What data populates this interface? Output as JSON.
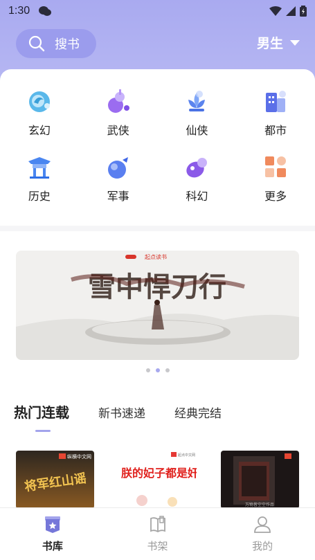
{
  "status_bar": {
    "time": "1:30"
  },
  "header": {
    "search_label": "搜书",
    "gender_label": "男生"
  },
  "categories": [
    {
      "label": "玄幻",
      "icon": "xuanhuan-icon"
    },
    {
      "label": "武侠",
      "icon": "wuxia-icon"
    },
    {
      "label": "仙侠",
      "icon": "xianxia-icon"
    },
    {
      "label": "都市",
      "icon": "dushi-icon"
    },
    {
      "label": "历史",
      "icon": "lishi-icon"
    },
    {
      "label": "军事",
      "icon": "junshi-icon"
    },
    {
      "label": "科幻",
      "icon": "kehuan-icon"
    },
    {
      "label": "更多",
      "icon": "more-icon"
    }
  ],
  "banner": {
    "brand": "起点读书",
    "title": "雪中悍刀行",
    "carousel_total": 3,
    "carousel_active": 2
  },
  "tabs": [
    {
      "label": "热门连载",
      "active": true
    },
    {
      "label": "新书速递",
      "active": false
    },
    {
      "label": "经典完结",
      "active": false
    }
  ],
  "books": [
    {
      "cover_title": "将军红山谣",
      "publisher": "纵横中文网"
    },
    {
      "cover_title": "朕的妃子都是奸",
      "publisher": "起点中文网"
    },
    {
      "cover_title": "",
      "publisher": "万物皆空空作品"
    }
  ],
  "bottom_nav": [
    {
      "label": "书库",
      "icon": "library-icon",
      "active": true
    },
    {
      "label": "书架",
      "icon": "bookshelf-icon",
      "active": false
    },
    {
      "label": "我的",
      "icon": "profile-icon",
      "active": false
    }
  ],
  "colors": {
    "header": "#a9aaf0",
    "accent": "#a3a4ec",
    "search_pill": "#9b9ced"
  }
}
